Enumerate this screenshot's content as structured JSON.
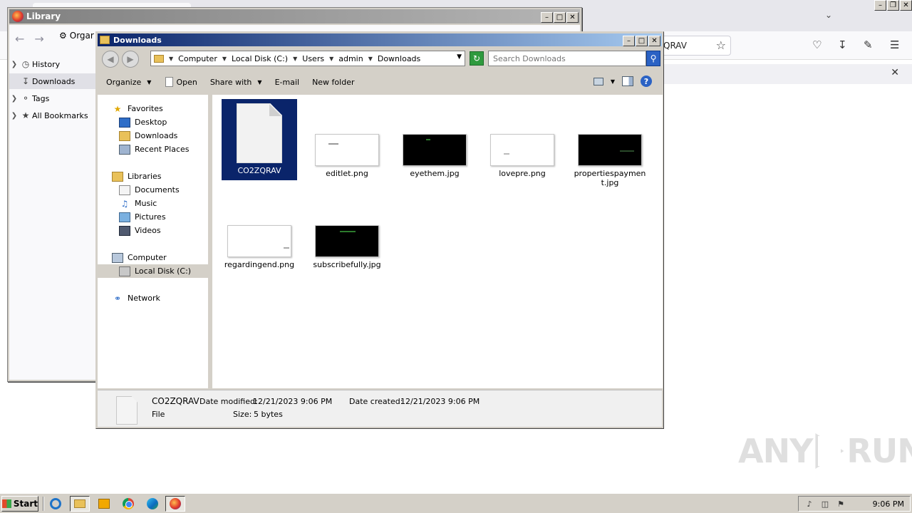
{
  "firefox": {
    "urlbar_partial_text": "QRAV",
    "icons": [
      "star-icon",
      "pocket-icon",
      "download-icon",
      "extensions-icon",
      "menu-icon",
      "close-icon"
    ]
  },
  "library": {
    "title": "Library",
    "organize_partial": "Orgar",
    "sidebar": [
      {
        "label": "History",
        "icon": "clock-icon",
        "expandable": true
      },
      {
        "label": "Downloads",
        "icon": "download-icon",
        "expandable": false,
        "selected": true
      },
      {
        "label": "Tags",
        "icon": "tag-icon",
        "expandable": true
      },
      {
        "label": "All Bookmarks",
        "icon": "star-icon",
        "expandable": true
      }
    ]
  },
  "explorer": {
    "title": "Downloads",
    "breadcrumb": [
      "Computer",
      "Local Disk (C:)",
      "Users",
      "admin",
      "Downloads"
    ],
    "search_placeholder": "Search Downloads",
    "commands": {
      "organize": "Organize",
      "open": "Open",
      "share_with": "Share with",
      "email": "E-mail",
      "new_folder": "New folder"
    },
    "nav": {
      "favorites": {
        "label": "Favorites",
        "items": [
          "Desktop",
          "Downloads",
          "Recent Places"
        ]
      },
      "libraries": {
        "label": "Libraries",
        "items": [
          "Documents",
          "Music",
          "Pictures",
          "Videos"
        ]
      },
      "computer": {
        "label": "Computer",
        "items": [
          "Local Disk (C:)"
        ]
      },
      "network": {
        "label": "Network"
      }
    },
    "files": [
      {
        "name": "CO2ZQRAV",
        "kind": "blank",
        "selected": true
      },
      {
        "name": "editlet.png",
        "kind": "white"
      },
      {
        "name": "eyethem.jpg",
        "kind": "black"
      },
      {
        "name": "lovepre.png",
        "kind": "white"
      },
      {
        "name": "propertiespayment.jpg",
        "kind": "black"
      },
      {
        "name": "regardingend.png",
        "kind": "white"
      },
      {
        "name": "subscribefully.jpg",
        "kind": "black"
      }
    ],
    "details": {
      "name": "CO2ZQRAV",
      "type": "File",
      "date_modified_label": "Date modified:",
      "date_modified": "12/21/2023 9:06 PM",
      "date_created_label": "Date created:",
      "date_created": "12/21/2023 9:06 PM",
      "size_label": "Size:",
      "size": "5 bytes"
    }
  },
  "taskbar": {
    "start": "Start",
    "apps": [
      "internet-explorer",
      "windows-explorer",
      "media-player",
      "chrome",
      "edge",
      "firefox"
    ],
    "clock": "9:06 PM"
  },
  "watermark": {
    "left": "ANY",
    "right": "RUN"
  }
}
